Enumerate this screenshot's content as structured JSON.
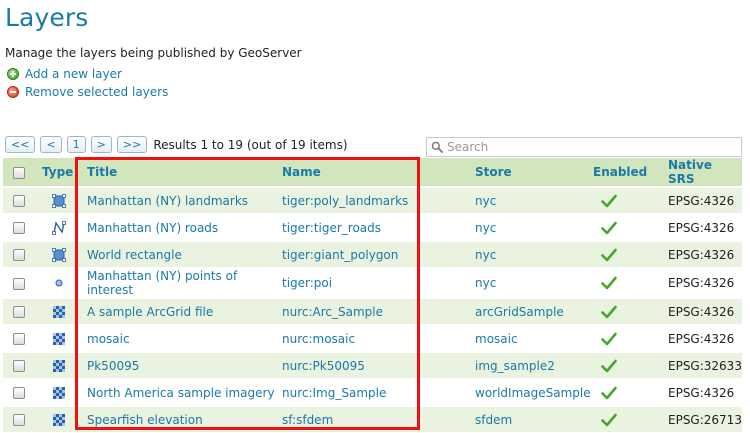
{
  "page": {
    "title": "Layers",
    "description": "Manage the layers being published by GeoServer"
  },
  "actions": {
    "add": "Add a new layer",
    "remove": "Remove selected layers"
  },
  "pager": {
    "first": "<<",
    "prev": "<",
    "current": "1",
    "next": ">",
    "last": ">>",
    "results": "Results 1 to 19 (out of 19 items)"
  },
  "search": {
    "placeholder": "Search"
  },
  "table": {
    "headers": {
      "type": "Type",
      "title": "Title",
      "name": "Name",
      "store": "Store",
      "enabled": "Enabled",
      "srs": "Native SRS"
    },
    "rows": [
      {
        "type": "polygon-layer-icon",
        "title": "Manhattan (NY) landmarks",
        "name": "tiger:poly_landmarks",
        "store": "nyc",
        "enabled": true,
        "srs": "EPSG:4326"
      },
      {
        "type": "line-layer-icon",
        "title": "Manhattan (NY) roads",
        "name": "tiger:tiger_roads",
        "store": "nyc",
        "enabled": true,
        "srs": "EPSG:4326"
      },
      {
        "type": "polygon-layer-icon",
        "title": "World rectangle",
        "name": "tiger:giant_polygon",
        "store": "nyc",
        "enabled": true,
        "srs": "EPSG:4326"
      },
      {
        "type": "point-layer-icon",
        "title": "Manhattan (NY) points of interest",
        "name": "tiger:poi",
        "store": "nyc",
        "enabled": true,
        "srs": "EPSG:4326"
      },
      {
        "type": "raster-layer-icon",
        "title": "A sample ArcGrid file",
        "name": "nurc:Arc_Sample",
        "store": "arcGridSample",
        "enabled": true,
        "srs": "EPSG:4326"
      },
      {
        "type": "raster-layer-icon",
        "title": "mosaic",
        "name": "nurc:mosaic",
        "store": "mosaic",
        "enabled": true,
        "srs": "EPSG:4326"
      },
      {
        "type": "raster-layer-icon",
        "title": "Pk50095",
        "name": "nurc:Pk50095",
        "store": "img_sample2",
        "enabled": true,
        "srs": "EPSG:32633"
      },
      {
        "type": "raster-layer-icon",
        "title": "North America sample imagery",
        "name": "nurc:Img_Sample",
        "store": "worldImageSample",
        "enabled": true,
        "srs": "EPSG:4326"
      },
      {
        "type": "raster-layer-icon",
        "title": "Spearfish elevation",
        "name": "sf:sfdem",
        "store": "sfdem",
        "enabled": true,
        "srs": "EPSG:26713"
      }
    ]
  },
  "colors": {
    "link": "#1b79a8",
    "header_bg": "#d2e6bd",
    "row_alt_bg": "#e9f3df",
    "highlight": "#ee1111"
  }
}
